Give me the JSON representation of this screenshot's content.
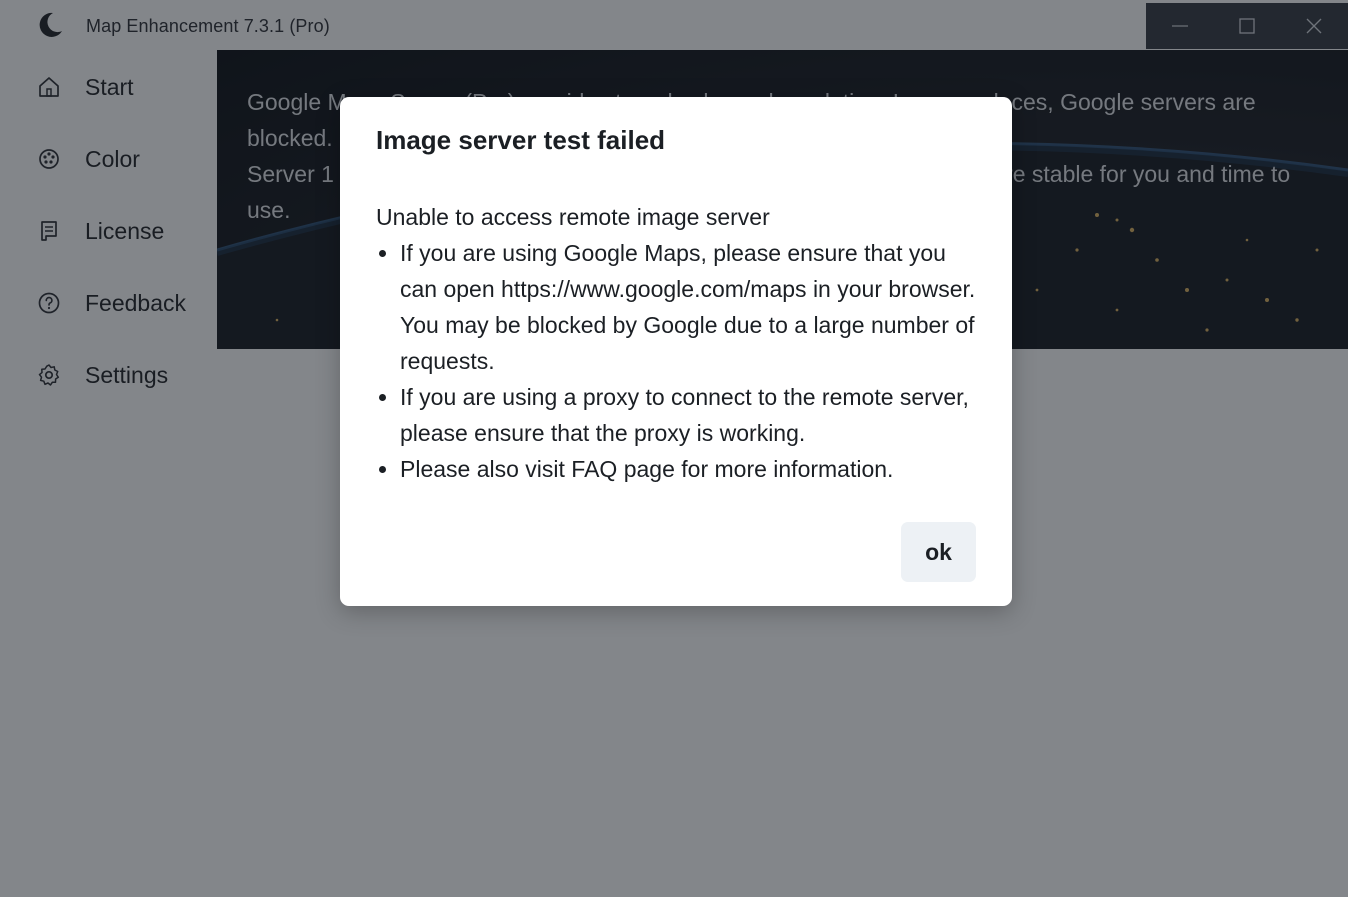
{
  "window": {
    "title": "Map Enhancement 7.3.1 (Pro)",
    "logo_icon": "moon-icon",
    "controls": [
      {
        "name": "minimize",
        "icon": "minimize-icon"
      },
      {
        "name": "maximize",
        "icon": "maximize-icon"
      },
      {
        "name": "close",
        "icon": "close-icon"
      }
    ],
    "controls_bg": "#333943"
  },
  "sidebar": {
    "items": [
      {
        "label": "Start",
        "icon": "home-icon"
      },
      {
        "label": "Color",
        "icon": "palette-icon"
      },
      {
        "label": "License",
        "icon": "license-icon"
      },
      {
        "label": "Feedback",
        "icon": "help-circle-icon"
      },
      {
        "label": "Settings",
        "icon": "gear-icon"
      }
    ]
  },
  "main": {
    "hero": {
      "line1": "Google Maps Server (Pro) provides tuned color and resolution. In some places, Google servers are",
      "line2": "blocked.",
      "line3": "Server 1 (Pro) is an alternative image server. Choose whichever one is more stable for you and time to use."
    }
  },
  "dialog": {
    "title": "Image server test failed",
    "intro": "Unable to access remote image server",
    "bullets": [
      "If you are using Google Maps, please ensure that you can open https://www.google.com/maps in your browser. You may be blocked by Google due to a large number of requests.",
      "If you are using a proxy to connect to the remote server, please ensure that the proxy is working.",
      "Please also visit FAQ page for more information."
    ],
    "ok_label": "ok"
  }
}
